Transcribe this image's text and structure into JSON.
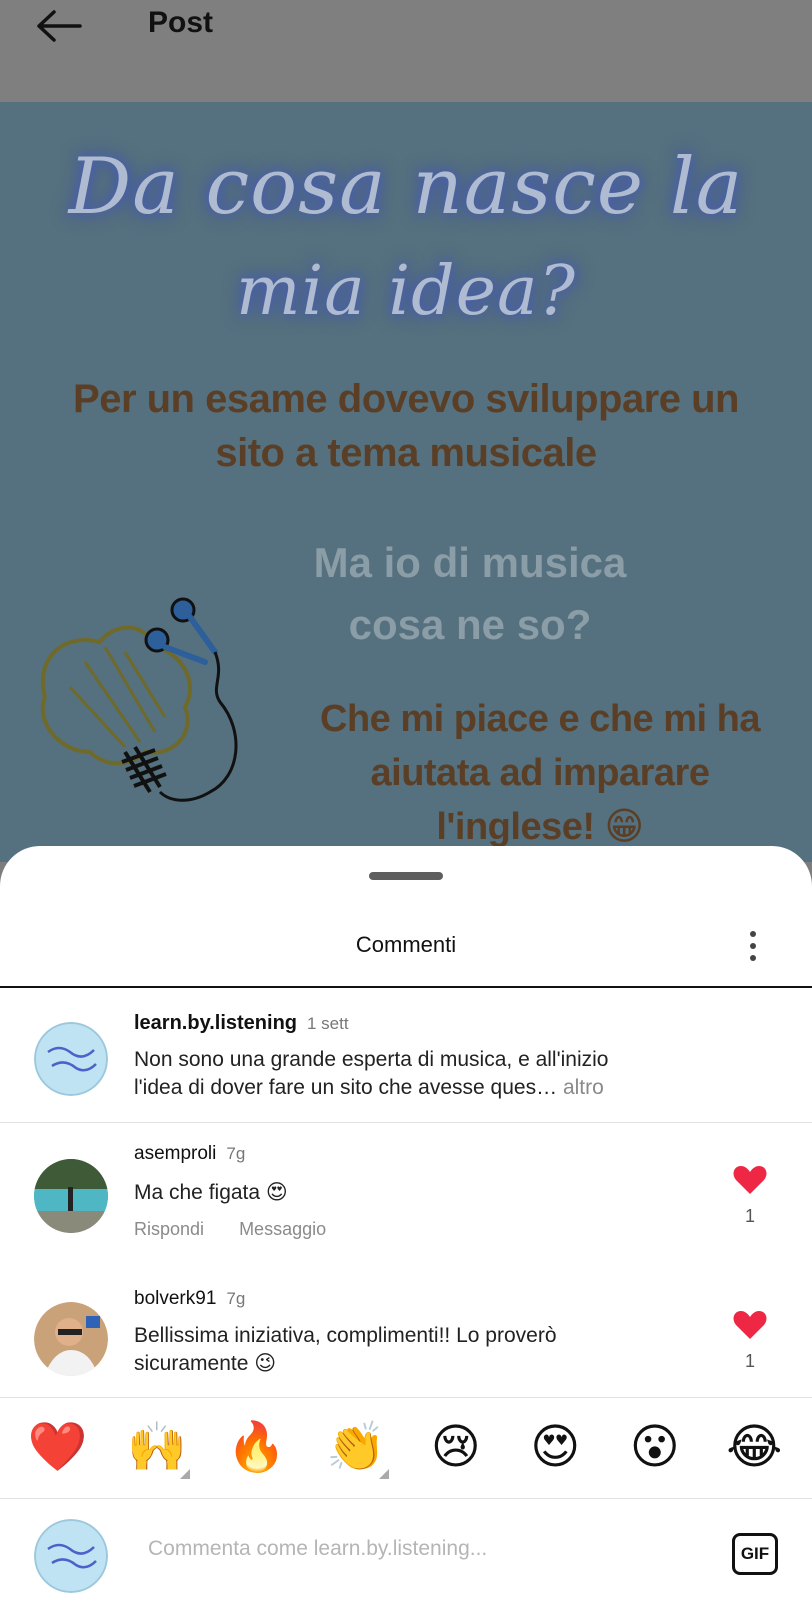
{
  "header": {
    "title": "Post",
    "back_icon": "arrow-left-icon"
  },
  "post": {
    "script_line1": "Da cosa nasce la",
    "script_line2": "mia idea?",
    "line1": "Per un esame dovevo sviluppare un",
    "line2": "sito a tema musicale",
    "grey_line1": "Ma io di musica",
    "grey_line2": "cosa ne so?",
    "line3": "Che mi piace e che mi ha",
    "line4": "aiutata ad imparare",
    "line5": "l'inglese! 😁"
  },
  "sheet": {
    "title": "Commenti",
    "more_icon": "more-vertical-icon"
  },
  "comments": [
    {
      "username": "learn.by.listening",
      "time": "1 sett",
      "text_line1": "Non sono una grande esperta di musica, e all'inizio",
      "text_line2": "l'idea di dover fare un sito che avesse ques…",
      "more": "altro"
    },
    {
      "username": "asemproli",
      "time": "7g",
      "text": "Ma che figata 😍",
      "reply": "Rispondi",
      "message": "Messaggio",
      "likes": "1"
    },
    {
      "username": "bolverk91",
      "time": "7g",
      "text_line1": "Bellissima iniziativa, complimenti!! Lo proverò",
      "text_line2": "sicuramente 😉",
      "likes": "1"
    }
  ],
  "reactions": [
    "❤️",
    "🙌",
    "🔥",
    "👏",
    "😢",
    "😍",
    "😮",
    "😂"
  ],
  "composer": {
    "placeholder": "Commenta come learn.by.listening...",
    "gif_label": "GIF"
  },
  "colors": {
    "post_background": "#55707e",
    "brown_text": "#5a3f26",
    "like_red": "#ee2744"
  }
}
